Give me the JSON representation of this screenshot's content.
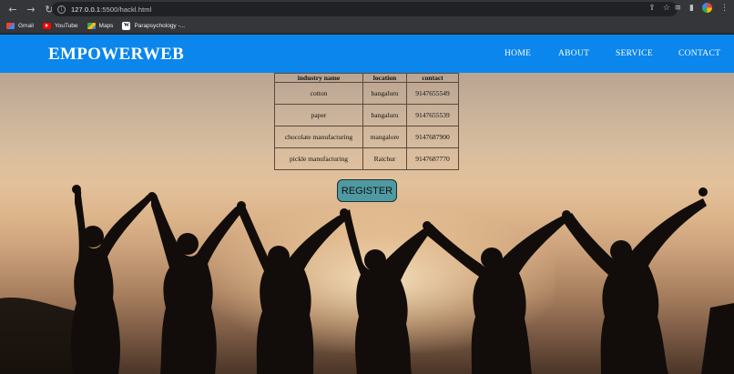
{
  "browser": {
    "url_host": "127.0.0.1",
    "url_path": ":5500/hackl.html",
    "bookmarks": [
      {
        "label": "Gmail",
        "icon": "gmail-icon"
      },
      {
        "label": "YouTube",
        "icon": "youtube-icon"
      },
      {
        "label": "Maps",
        "icon": "maps-icon"
      },
      {
        "label": "Parapsychology -...",
        "icon": "wikipedia-icon"
      }
    ]
  },
  "header": {
    "brand": "EMPOWERWEB",
    "nav": {
      "home": "HOME",
      "about": "ABOUT",
      "service": "SERVICE",
      "contact": "CONTACT"
    },
    "color": "#0b86ec"
  },
  "table": {
    "headers": [
      "industry name",
      "location",
      "contact"
    ],
    "rows": [
      [
        "cotton",
        "bangaluru",
        "9147655549"
      ],
      [
        "paper",
        "bangaluru",
        "9147655539"
      ],
      [
        "chocolate manufacturing",
        "mangalore",
        "9147687900"
      ],
      [
        "pickle manufacturing",
        "Raichur",
        "9147687770"
      ]
    ]
  },
  "register": {
    "label": "REGISTER",
    "color": "#4f9aa2"
  }
}
